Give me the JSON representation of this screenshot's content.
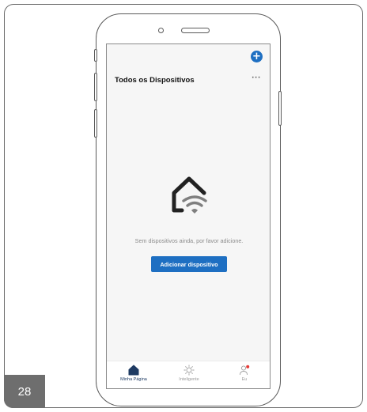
{
  "page": {
    "number": "28"
  },
  "header": {
    "title": "Todos os Dispositivos",
    "more": "···"
  },
  "empty_state": {
    "message": "Sem dispositivos ainda, por favor adicione.",
    "button_label": "Adicionar dispositivo"
  },
  "tabs": [
    {
      "label": "Minha Página",
      "icon": "home-icon",
      "active": true
    },
    {
      "label": "Inteligente",
      "icon": "sun-icon",
      "active": false
    },
    {
      "label": "Eu",
      "icon": "user-icon",
      "active": false
    }
  ],
  "colors": {
    "accent": "#1e6fc2",
    "badge": "#6e6e6e",
    "notification": "#e53935"
  }
}
